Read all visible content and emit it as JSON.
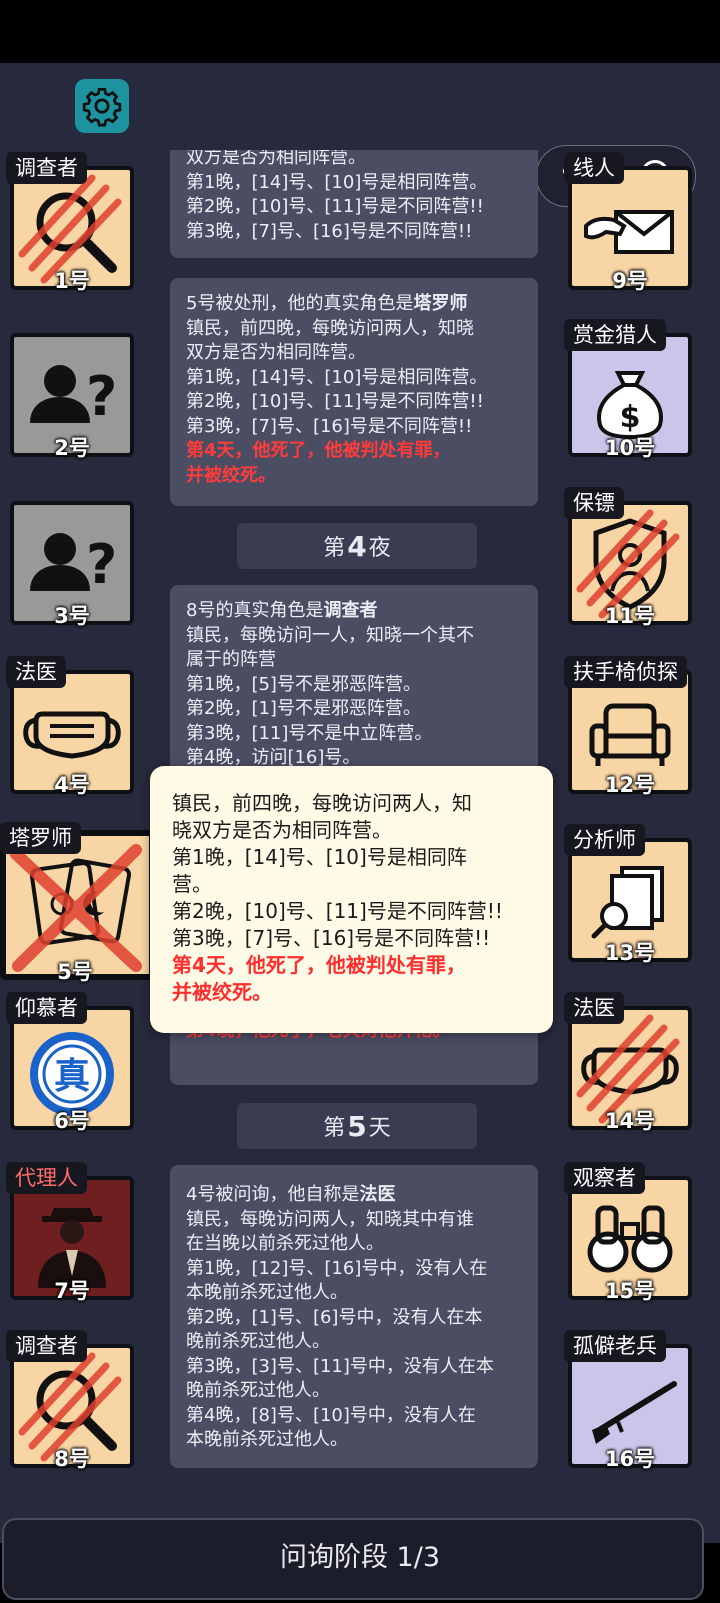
{
  "header": {
    "settings_icon": "gear-icon"
  },
  "capsule": {
    "more_icon": "more-dots-icon",
    "close_icon": "target-circle-icon"
  },
  "log": {
    "card1": {
      "lines": [
        "双方是否为相同阵营。",
        "第1晚，[14]号、[10]号是相同阵营。",
        "第2晚，[10]号、[11]号是不同阵营!!",
        "第3晚，[7]号、[16]号是不同阵营!!"
      ]
    },
    "card2": {
      "intro": "5号被处刑，他的真实角色是",
      "role": "塔罗师",
      "lines": [
        "镇民，前四晚，每晚访问两人，知晓",
        "双方是否为相同阵营。",
        "第1晚，[14]号、[10]号是相同阵营。",
        "第2晚，[10]号、[11]号是不同阵营!!",
        "第3晚，[7]号、[16]号是不同阵营!!"
      ],
      "red": [
        "第4天，他死了，他被判处有罪，",
        "并被绞死。"
      ]
    },
    "night4": {
      "prefix": "第",
      "num": "4",
      "suffix": "夜"
    },
    "card3": {
      "intro": "8号的真实角色是",
      "role": "调查者",
      "lines": [
        "镇民，每晚访问一人，知晓一个其不",
        "属于的阵营",
        "第1晚，[5]号不是邪恶阵营。",
        "第2晚，[1]号不是邪恶阵营。",
        "第3晚，[11]号不是中立阵营。",
        "第4晚，访问[16]号。"
      ],
      "red": [
        "第4晚，他死了，老兵对他开枪。"
      ]
    },
    "day5": {
      "prefix": "第",
      "num": "5",
      "suffix": "天"
    },
    "card4": {
      "intro": "4号被问询，他自称是",
      "role": "法医",
      "lines": [
        "镇民，每晚访问两人，知晓其中有谁",
        "在当晚以前杀死过他人。",
        "第1晚，[12]号、[16]号中，没有人在",
        "本晚前杀死过他人。",
        "第2晚，[1]号、[6]号中，没有人在本",
        "晚前杀死过他人。",
        "第3晚，[3]号、[11]号中，没有人在本",
        "晚前杀死过他人。",
        "第4晚，[8]号、[10]号中，没有人在",
        "本晚前杀死过他人。"
      ]
    }
  },
  "popup": {
    "lines": [
      "镇民，前四晚，每晚访问两人，知",
      "晓双方是否为相同阵营。",
      "第1晚，[14]号、[10]号是相同阵",
      "营。",
      "第2晚，[10]号、[11]号是不同阵营!!",
      "第3晚，[7]号、[16]号是不同阵营!!"
    ],
    "red": [
      "第4天，他死了，他被判处有罪，",
      "并被绞死。"
    ]
  },
  "players_left": [
    {
      "role": "调查者",
      "num": "1号",
      "icon": "magnifier-icon",
      "state": "dead"
    },
    {
      "role": "",
      "num": "2号",
      "icon": "unknown-person-icon",
      "state": "unknown"
    },
    {
      "role": "",
      "num": "3号",
      "icon": "unknown-person-icon",
      "state": "unknown"
    },
    {
      "role": "法医",
      "num": "4号",
      "icon": "mask-icon",
      "state": "alive"
    },
    {
      "role": "塔罗师",
      "num": "5号",
      "icon": "tarot-cards-icon",
      "state": "executed"
    },
    {
      "role": "仰慕者",
      "num": "6号",
      "icon": "true-seal-icon",
      "state": "alive"
    },
    {
      "role": "代理人",
      "num": "7号",
      "icon": "agent-suit-icon",
      "state": "evil"
    },
    {
      "role": "调查者",
      "num": "8号",
      "icon": "magnifier-icon",
      "state": "dead"
    }
  ],
  "players_right": [
    {
      "role": "线人",
      "num": "9号",
      "icon": "envelope-hand-icon",
      "state": "alive"
    },
    {
      "role": "赏金猎人",
      "num": "10号",
      "icon": "money-bag-icon",
      "state": "neutral"
    },
    {
      "role": "保镖",
      "num": "11号",
      "icon": "shield-person-icon",
      "state": "dead"
    },
    {
      "role": "扶手椅侦探",
      "num": "12号",
      "icon": "armchair-icon",
      "state": "alive"
    },
    {
      "role": "分析师",
      "num": "13号",
      "icon": "documents-search-icon",
      "state": "alive"
    },
    {
      "role": "法医",
      "num": "14号",
      "icon": "mask-icon",
      "state": "dead"
    },
    {
      "role": "观察者",
      "num": "15号",
      "icon": "binoculars-icon",
      "state": "alive"
    },
    {
      "role": "孤僻老兵",
      "num": "16号",
      "icon": "rifle-icon",
      "state": "neutral"
    }
  ],
  "footer": {
    "phase_label": "问询阶段 1/3"
  },
  "colors": {
    "accent_red": "#ff3b3b",
    "card_bg": "#4b4d63",
    "popup_bg": "#fffbe6",
    "tile_bg": "#f7d5a4",
    "gear_bg": "#1e93a0"
  }
}
